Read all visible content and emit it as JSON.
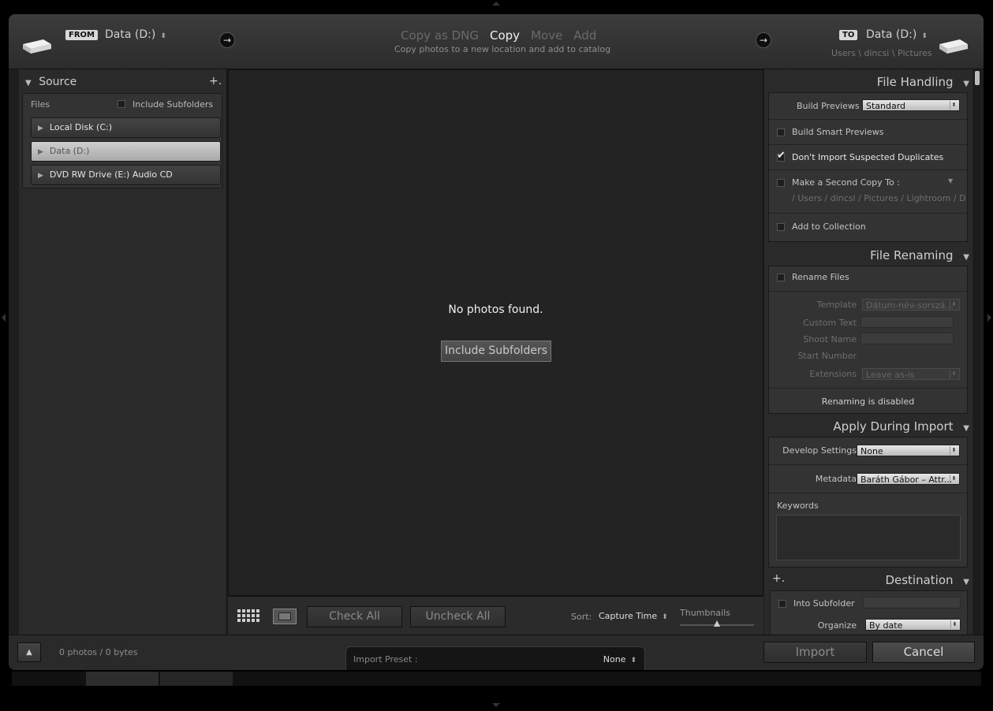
{
  "top": {
    "from_badge": "FROM",
    "from_volume": "Data (D:)",
    "to_badge": "TO",
    "to_volume": "Data (D:)",
    "to_path": "Users \\ dincsi \\ Pictures",
    "modes": [
      "Copy as DNG",
      "Copy",
      "Move",
      "Add"
    ],
    "active_mode": "Copy",
    "mode_description": "Copy photos to a new location and add to catalog",
    "updown_glyph": "⬍",
    "arrow_glyph": "→"
  },
  "source": {
    "title": "Source",
    "add_glyph": "+.",
    "files_label": "Files",
    "include_subfolders_label": "Include Subfolders",
    "include_subfolders_checked": false,
    "items": [
      {
        "label": "Local Disk (C:)",
        "selected": false
      },
      {
        "label": "Data (D:)",
        "selected": true
      },
      {
        "label": "DVD RW Drive (E:) Audio CD",
        "selected": false
      }
    ]
  },
  "center": {
    "empty_message": "No photos found.",
    "include_subfolders_button": "Include Subfolders"
  },
  "toolbar": {
    "check_all": "Check All",
    "uncheck_all": "Uncheck All",
    "sort_label": "Sort:",
    "sort_value": "Capture Time",
    "thumbnails_label": "Thumbnails",
    "thumbnail_size": 0.5
  },
  "file_handling": {
    "title": "File Handling",
    "build_previews_label": "Build Previews",
    "build_previews_value": "Standard",
    "build_smart_previews": "Build Smart Previews",
    "dont_import_duplicates": "Don't Import Suspected Duplicates",
    "dont_import_duplicates_checked": true,
    "second_copy": "Make a Second Copy To :",
    "second_copy_path": "/ Users / dincsi / Pictures / Lightroom / D",
    "add_to_collection": "Add to Collection"
  },
  "file_renaming": {
    "title": "File Renaming",
    "rename_files": "Rename Files",
    "template_label": "Template",
    "template_value": "Dátum-név-sorszá...",
    "custom_text_label": "Custom Text",
    "shoot_name_label": "Shoot Name",
    "start_number_label": "Start Number",
    "extensions_label": "Extensions",
    "extensions_value": "Leave as-is",
    "disabled_note": "Renaming is disabled"
  },
  "apply_during_import": {
    "title": "Apply During Import",
    "develop_settings_label": "Develop Settings",
    "develop_settings_value": "None",
    "metadata_label": "Metadata",
    "metadata_value": "Baráth Gábor – Attr...",
    "keywords_label": "Keywords"
  },
  "destination": {
    "title": "Destination",
    "add_glyph": "+.",
    "into_subfolder": "Into Subfolder",
    "organize_label": "Organize",
    "organize_value": "By date"
  },
  "bottom": {
    "summary": "0 photos / 0 bytes",
    "import_preset_label": "Import Preset :",
    "import_preset_value": "None",
    "import_button": "Import",
    "cancel_button": "Cancel",
    "expand_glyph": "▲"
  }
}
